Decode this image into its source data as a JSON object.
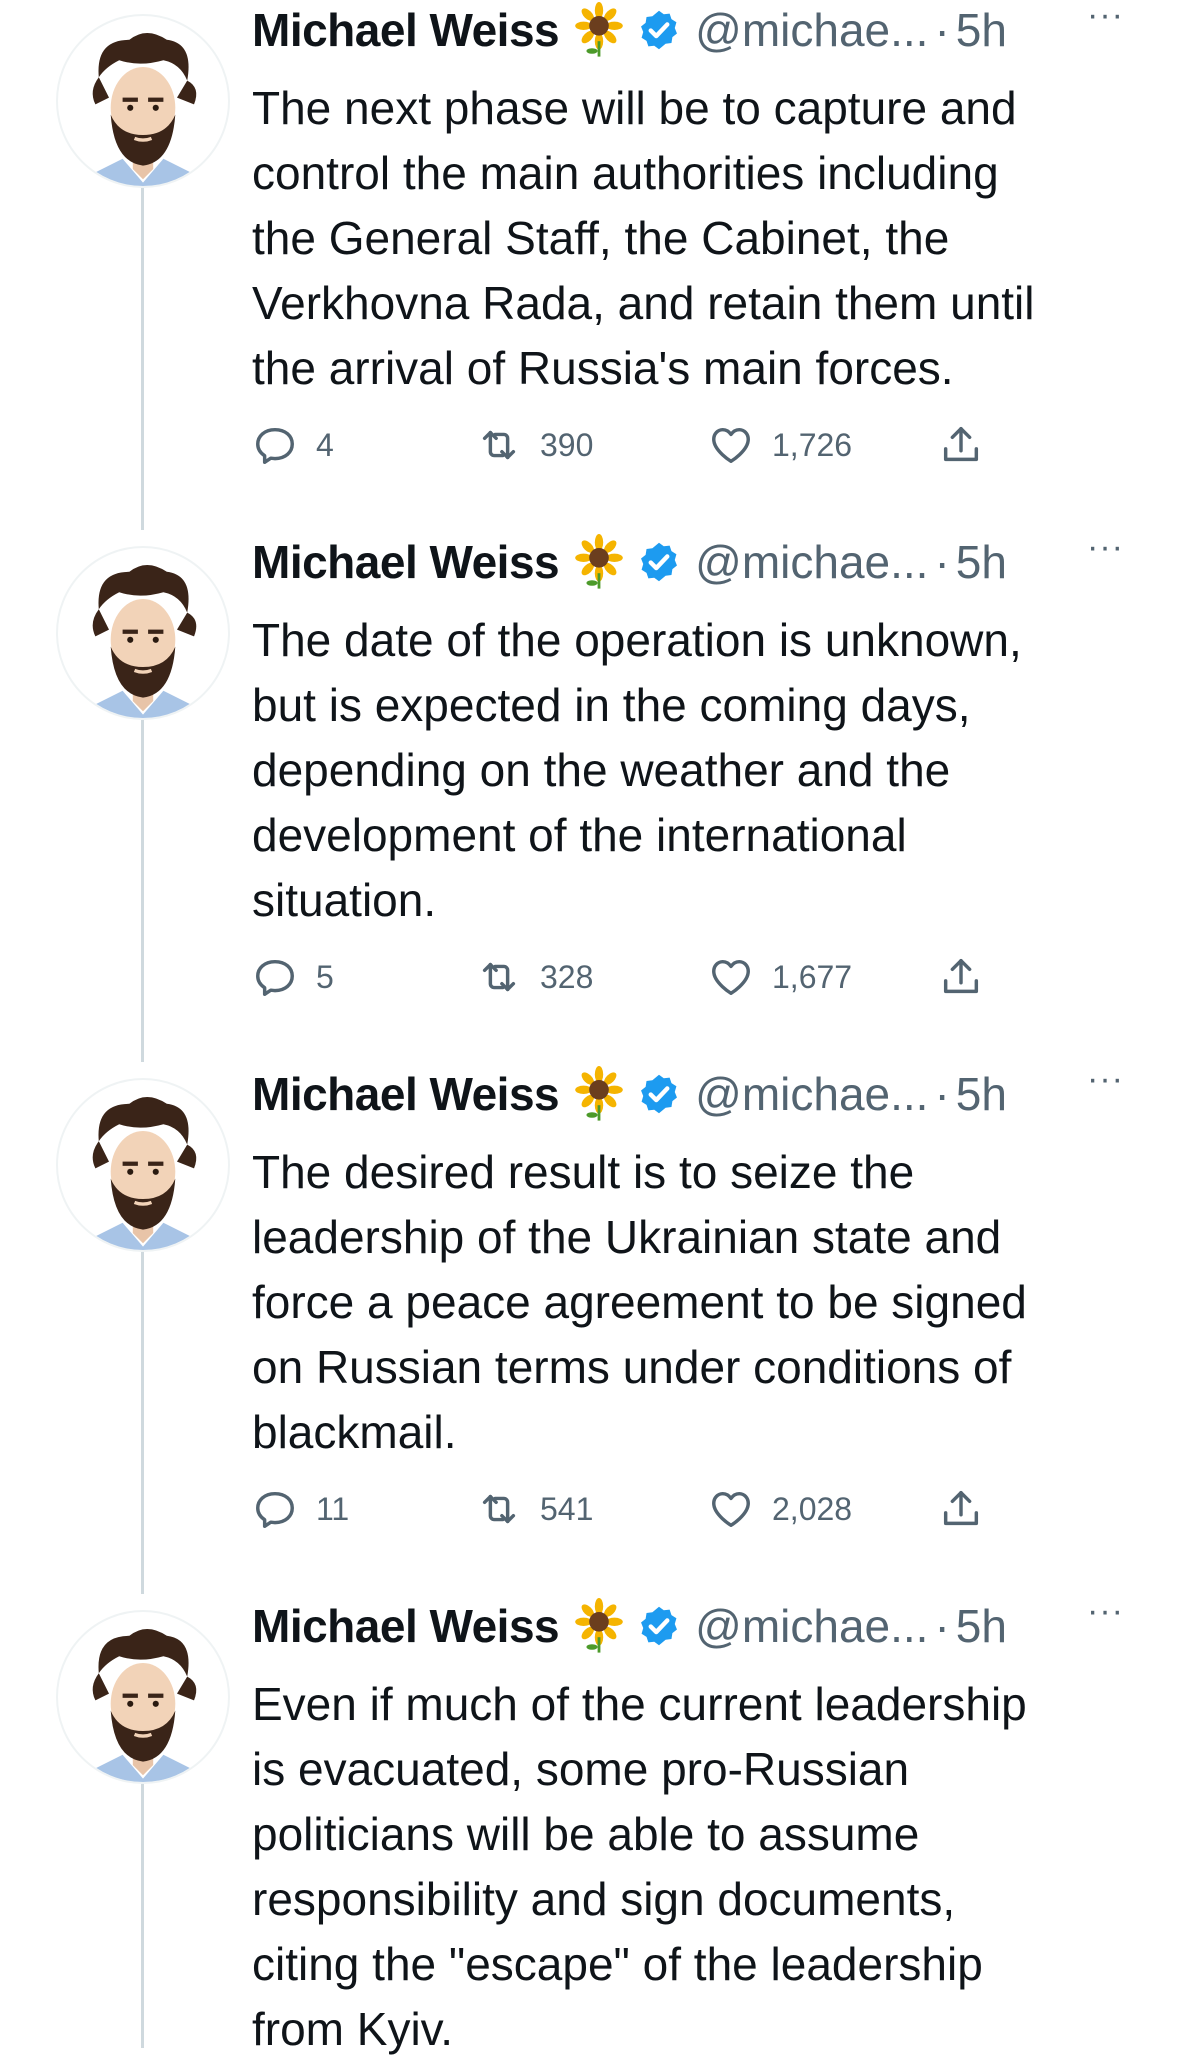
{
  "author": {
    "name": "Michael Weiss",
    "handle": "@michae...",
    "separator": "·",
    "more_glyph": "···",
    "badge_emoji": "sunflower-emoji",
    "verified_color": "#1d9bf0"
  },
  "tweets": [
    {
      "time": "5h",
      "lines": [
        "The next phase will be to capture and",
        "control the main authorities including",
        "the General Staff, the Cabinet, the",
        "Verkhovna Rada, and retain them until",
        "the arrival of Russia's main forces."
      ],
      "replies": "4",
      "retweets": "390",
      "likes": "1,726"
    },
    {
      "time": "5h",
      "lines": [
        "The date of the operation is unknown,",
        "but is expected in the coming days,",
        "depending on the weather and the",
        "development of the international",
        "situation."
      ],
      "replies": "5",
      "retweets": "328",
      "likes": "1,677"
    },
    {
      "time": "5h",
      "lines": [
        "The desired result is to seize the",
        "leadership of the Ukrainian state and",
        "force a peace agreement to be signed",
        "on Russian terms under conditions of",
        "blackmail."
      ],
      "replies": "11",
      "retweets": "541",
      "likes": "2,028"
    },
    {
      "time": "5h",
      "lines": [
        "Even if much of the current leadership",
        "is evacuated, some pro-Russian",
        "politicians will be able to assume",
        "responsibility and sign documents,",
        "citing the \"escape\" of the leadership",
        "from Kyiv."
      ]
    }
  ]
}
